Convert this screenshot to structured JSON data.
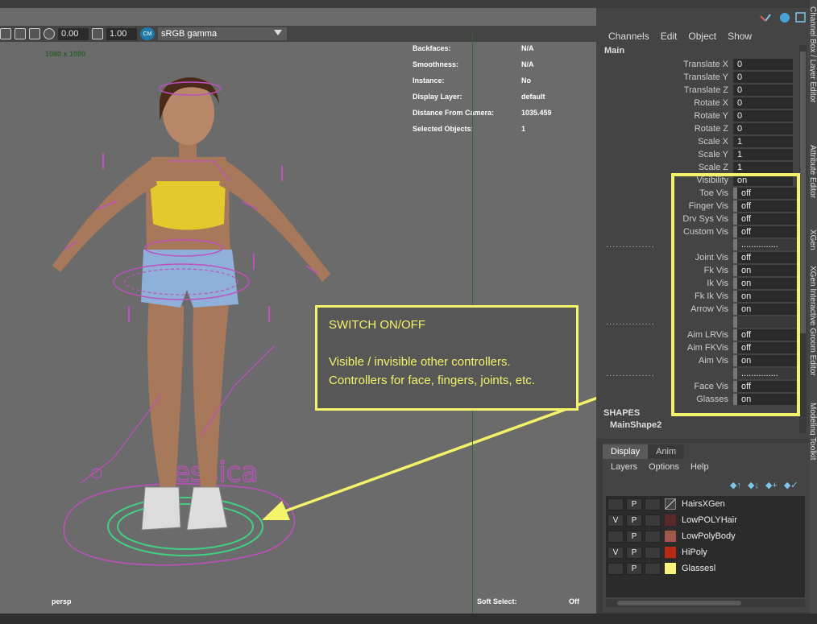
{
  "toolbar": {
    "exposure": "0.00",
    "gamma": "1.00",
    "color_space": "sRGB gamma",
    "cm_label": "CM"
  },
  "viewport": {
    "resolution": "1080 x 1080",
    "camera": "persp",
    "hud": [
      {
        "key": "Backfaces:",
        "value": "N/A"
      },
      {
        "key": "Smoothness:",
        "value": "N/A"
      },
      {
        "key": "Instance:",
        "value": "No"
      },
      {
        "key": "Display Layer:",
        "value": "default"
      },
      {
        "key": "Distance From Camera:",
        "value": "1035.459"
      },
      {
        "key": "Selected Objects:",
        "value": "1"
      }
    ],
    "soft_select_label": "Soft Select:",
    "soft_select_value": "Off",
    "character_label": "essica"
  },
  "annotation": {
    "title": "SWITCH ON/OFF",
    "line1": "Visible / invisible other controllers.",
    "line2": "Controllers for face, fingers, joints, etc."
  },
  "channel_box": {
    "menu": [
      "Channels",
      "Edit",
      "Object",
      "Show"
    ],
    "object": "Main",
    "attrs": [
      {
        "label": "Translate X",
        "value": "0"
      },
      {
        "label": "Translate Y",
        "value": "0"
      },
      {
        "label": "Translate Z",
        "value": "0"
      },
      {
        "label": "Rotate X",
        "value": "0"
      },
      {
        "label": "Rotate Y",
        "value": "0"
      },
      {
        "label": "Rotate Z",
        "value": "0"
      },
      {
        "label": "Scale X",
        "value": "1"
      },
      {
        "label": "Scale Y",
        "value": "1"
      },
      {
        "label": "Scale Z",
        "value": "1"
      },
      {
        "label": "Visibility",
        "value": "on"
      },
      {
        "label": "Toe Vis",
        "value": "off"
      },
      {
        "label": "Finger Vis",
        "value": "off"
      },
      {
        "label": "Drv Sys Vis",
        "value": "off"
      },
      {
        "label": "Custom Vis",
        "value": "off"
      },
      {
        "label": "...............",
        "value": "..............."
      },
      {
        "label": "Joint Vis",
        "value": "off"
      },
      {
        "label": "Fk Vis",
        "value": "on"
      },
      {
        "label": "Ik Vis",
        "value": "on"
      },
      {
        "label": "Fk Ik Vis",
        "value": "on"
      },
      {
        "label": "Arrow Vis",
        "value": "on"
      },
      {
        "label": "...............",
        "value": ""
      },
      {
        "label": "Aim LRVis",
        "value": "off"
      },
      {
        "label": "Aim FKVis",
        "value": "off"
      },
      {
        "label": "Aim Vis",
        "value": "on"
      },
      {
        "label": "...............",
        "value": "..............."
      },
      {
        "label": "Face Vis",
        "value": "off"
      },
      {
        "label": "Glasses",
        "value": "on"
      }
    ],
    "shapes_header": "SHAPES",
    "shape_name": "MainShape2"
  },
  "side_tabs": [
    "Channel Box / Layer Editor",
    "Attribute Editor",
    "XGen",
    "XGen Interactive Groom Editor",
    "Modeling Toolkit"
  ],
  "layer_editor": {
    "tabs": [
      "Display",
      "Anim"
    ],
    "menu": [
      "Layers",
      "Options",
      "Help"
    ],
    "layers": [
      {
        "v": "",
        "p": "P",
        "color": "#444444",
        "name": "HairsXGen"
      },
      {
        "v": "V",
        "p": "P",
        "color": "#5a2a2a",
        "name": "LowPOLYHair"
      },
      {
        "v": "",
        "p": "P",
        "color": "#a0584a",
        "name": "LowPolyBody"
      },
      {
        "v": "V",
        "p": "P",
        "color": "#b82a14",
        "name": "HiPoly"
      },
      {
        "v": "",
        "p": "P",
        "color": "#f7f27a",
        "name": "Glassesl"
      }
    ]
  },
  "colors": {
    "annotation": "#f4f36a",
    "controller_magenta": "#c050c0",
    "controller_green": "#40d080"
  }
}
